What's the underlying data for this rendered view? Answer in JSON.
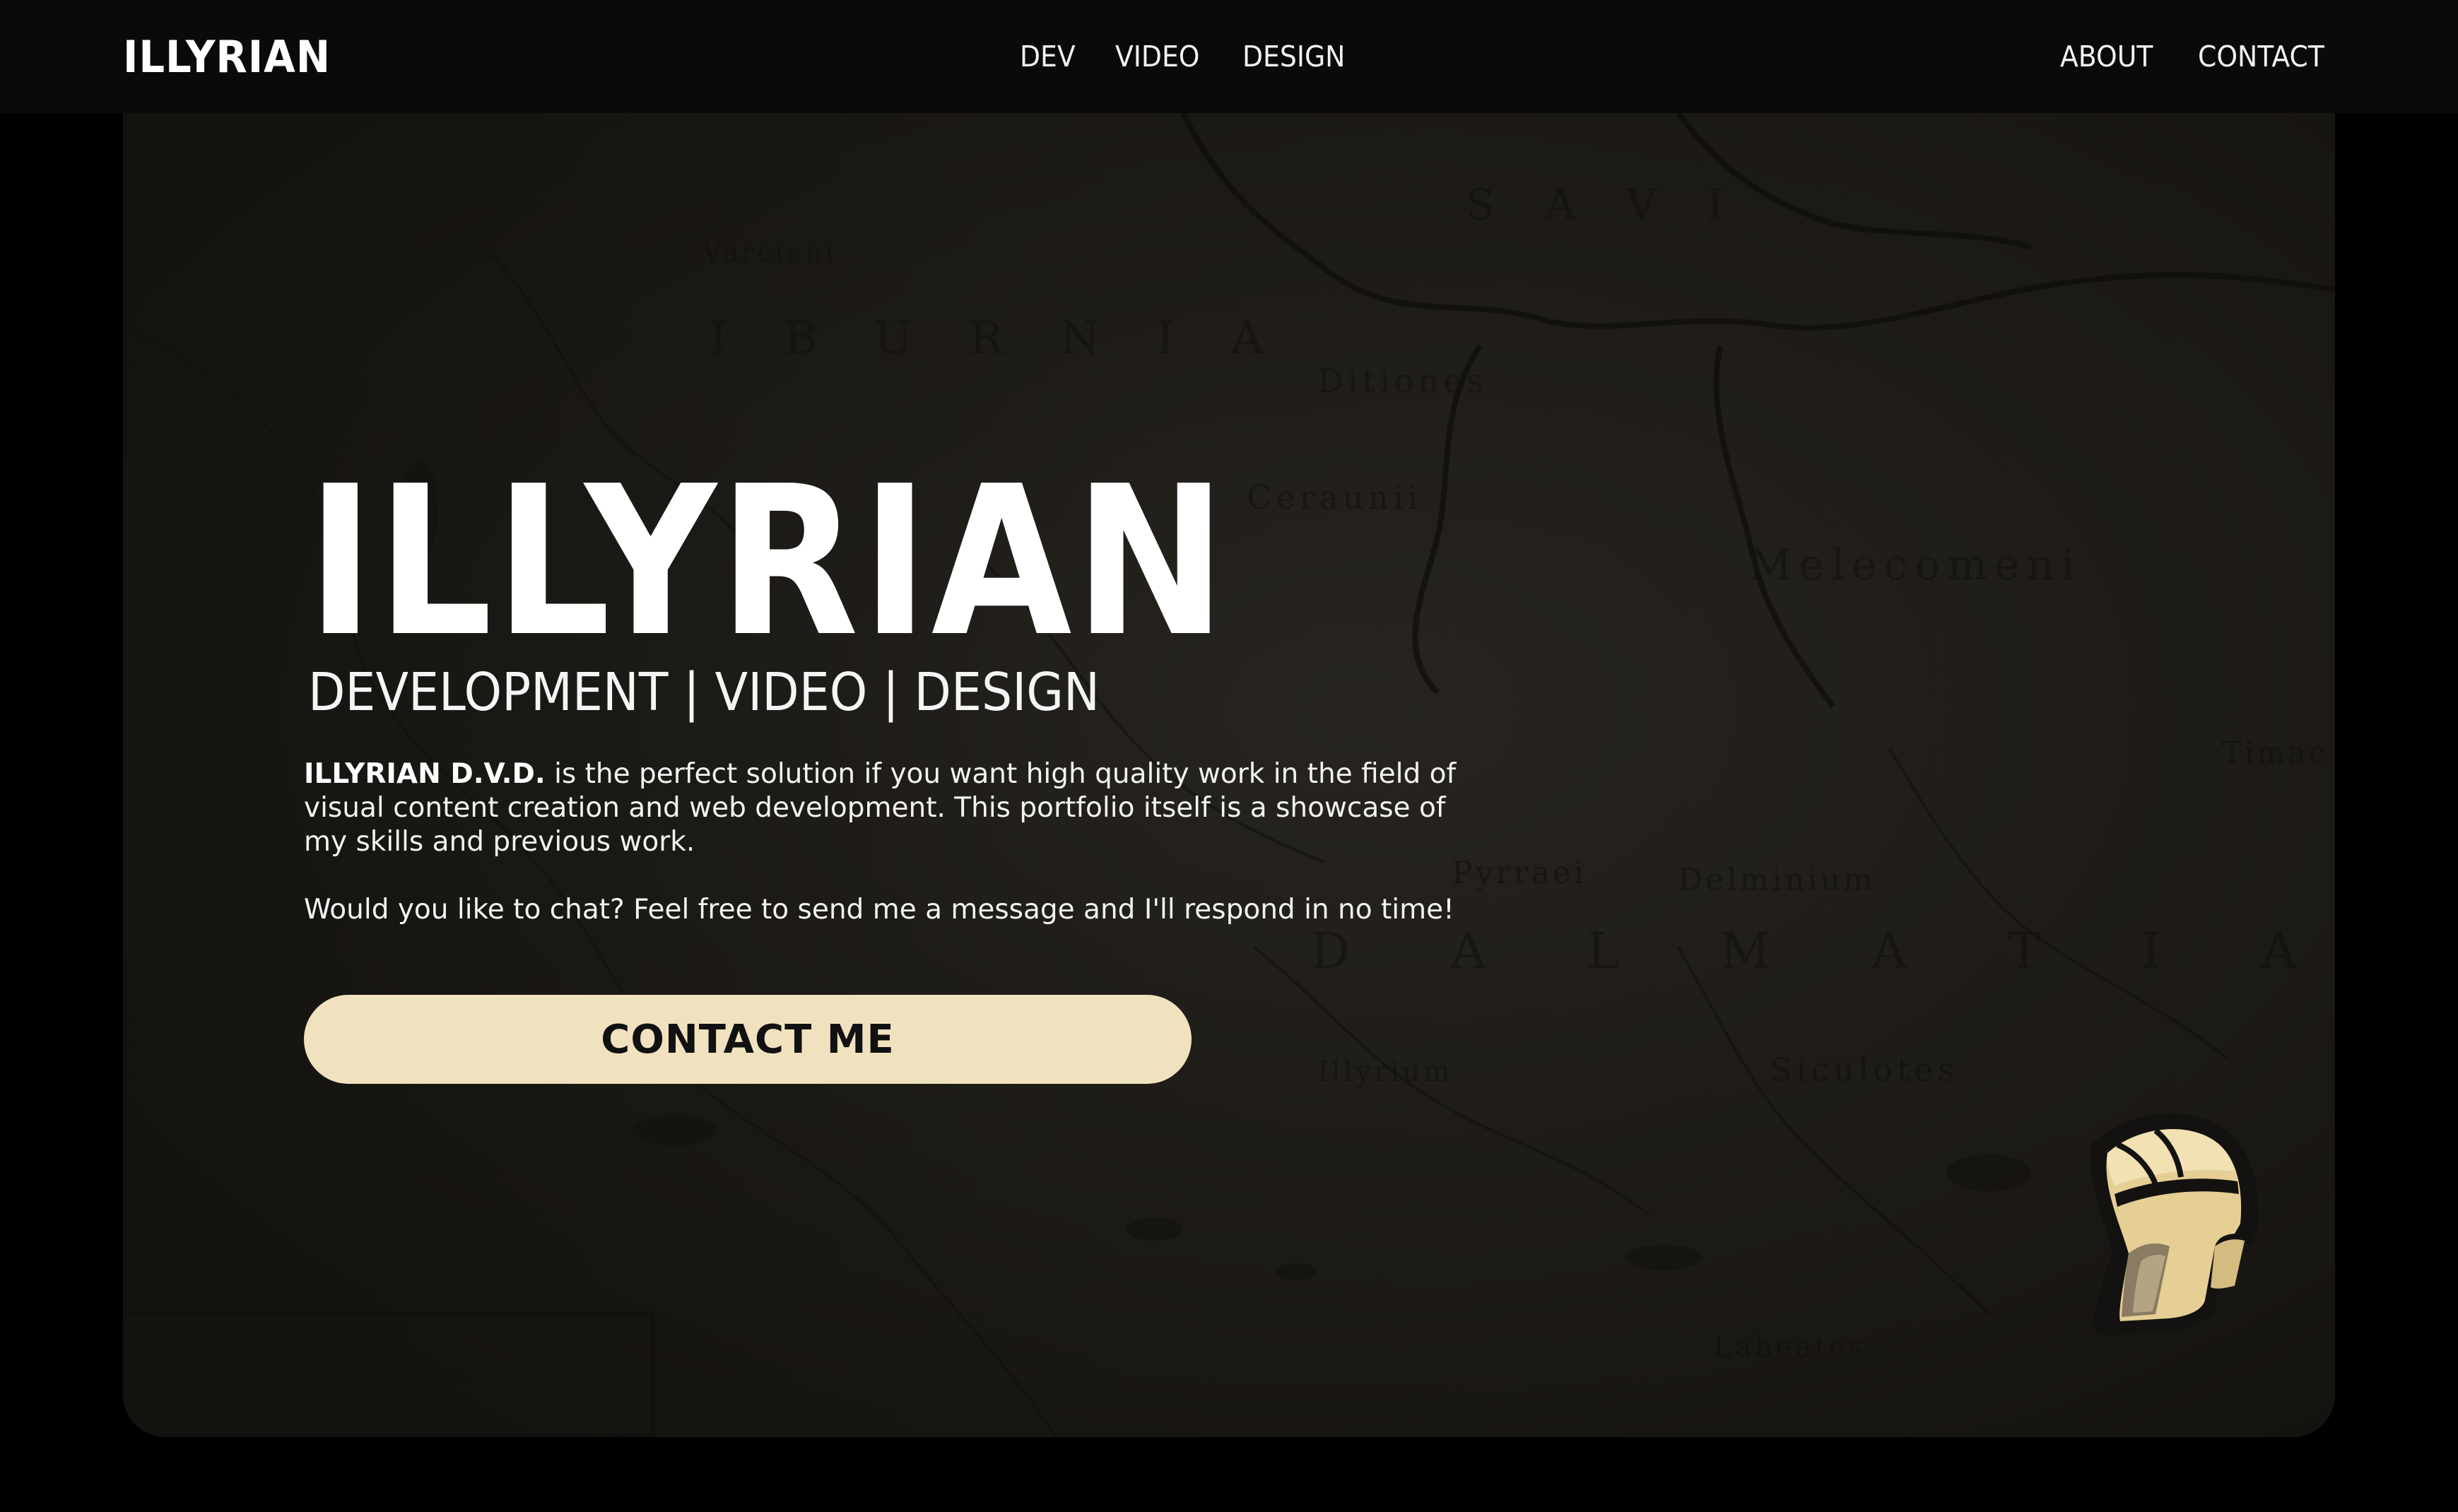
{
  "brand": {
    "logo_text": "ILLYRIAN"
  },
  "nav": {
    "center_links": [
      "DEV",
      "VIDEO",
      "DESIGN"
    ],
    "right_links": [
      "ABOUT",
      "CONTACT"
    ]
  },
  "hero": {
    "title": "ILLYRIAN",
    "subtitle": "DEVELOPMENT | VIDEO | DESIGN",
    "description_brand": "ILLYRIAN D.V.D.",
    "description_rest": " is the perfect solution if you want high quality work in the field of visual content creation and web development. This portfolio itself is a showcase of my skills and previous work.",
    "chat_text": "Would you like to chat? Feel free to send me a message and I'll respond in no time!",
    "cta_label": "CONTACT ME"
  },
  "colors": {
    "page_background": "#000000",
    "navbar_background": "#0b0a09",
    "hero_background": "#1d1b17",
    "cta_background": "#f1e2bf",
    "cta_text": "#111111",
    "helmet_main": "#e6cf94",
    "helmet_outline": "#141210"
  },
  "icons": {
    "mascot": "illyrian-helmet-icon"
  }
}
